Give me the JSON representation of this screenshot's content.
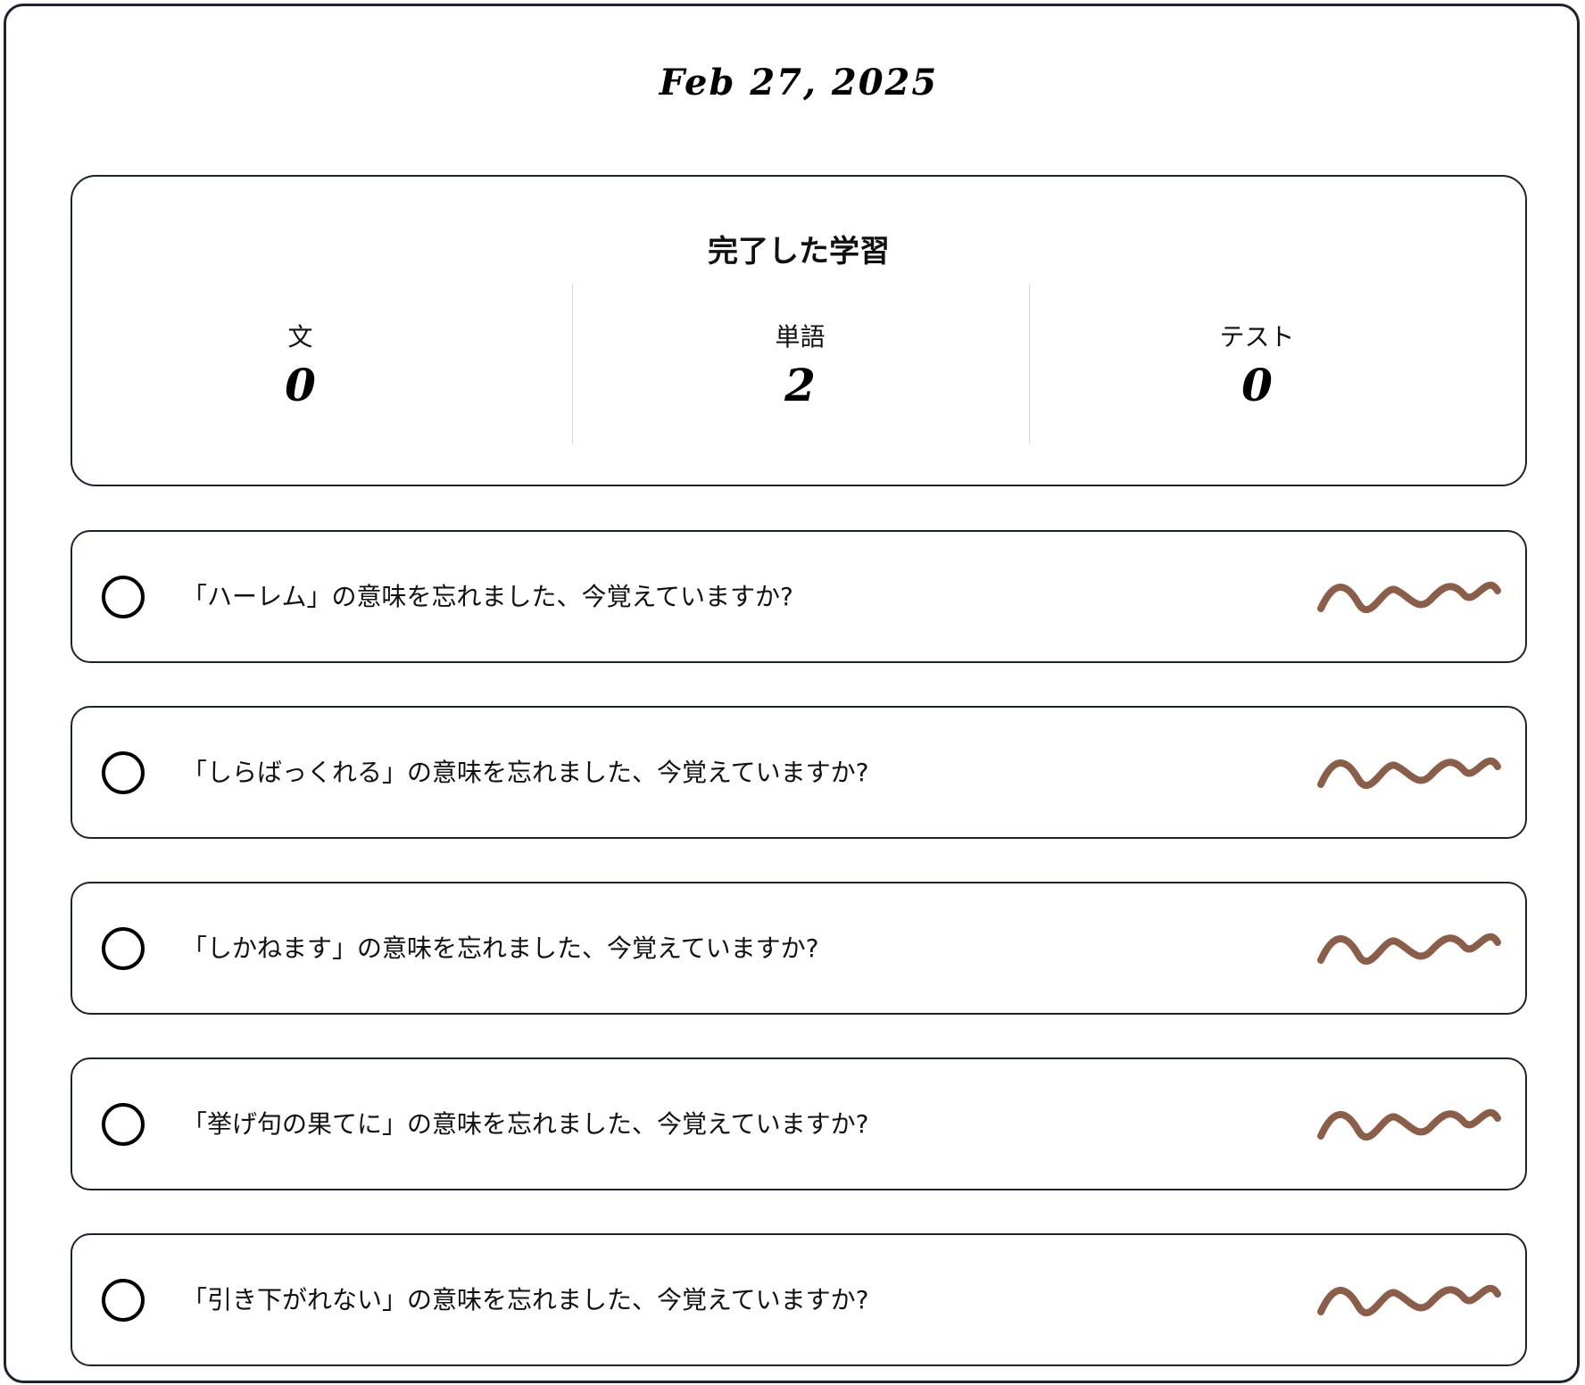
{
  "header": {
    "date": "Feb 27, 2025"
  },
  "summary": {
    "title": "完了した学習",
    "stats": [
      {
        "label": "文",
        "value": "0"
      },
      {
        "label": "単語",
        "value": "2"
      },
      {
        "label": "テスト",
        "value": "0"
      }
    ]
  },
  "tasks": [
    {
      "text": "「ハーレム」の意味を忘れました、今覚えていますか?",
      "icon": "squiggle-icon",
      "checked": false
    },
    {
      "text": "「しらばっくれる」の意味を忘れました、今覚えていますか?",
      "icon": "squiggle-icon",
      "checked": false
    },
    {
      "text": "「しかねます」の意味を忘れました、今覚えていますか?",
      "icon": "squiggle-icon",
      "checked": false
    },
    {
      "text": "「挙げ句の果てに」の意味を忘れました、今覚えていますか?",
      "icon": "squiggle-icon",
      "checked": false
    },
    {
      "text": "「引き下がれない」の意味を忘れました、今覚えていますか?",
      "icon": "squiggle-icon",
      "checked": false
    }
  ],
  "colors": {
    "border": "#1c2330",
    "squiggle": "#8b5e4a",
    "divider": "#d6d6d6",
    "text": "#111111"
  }
}
